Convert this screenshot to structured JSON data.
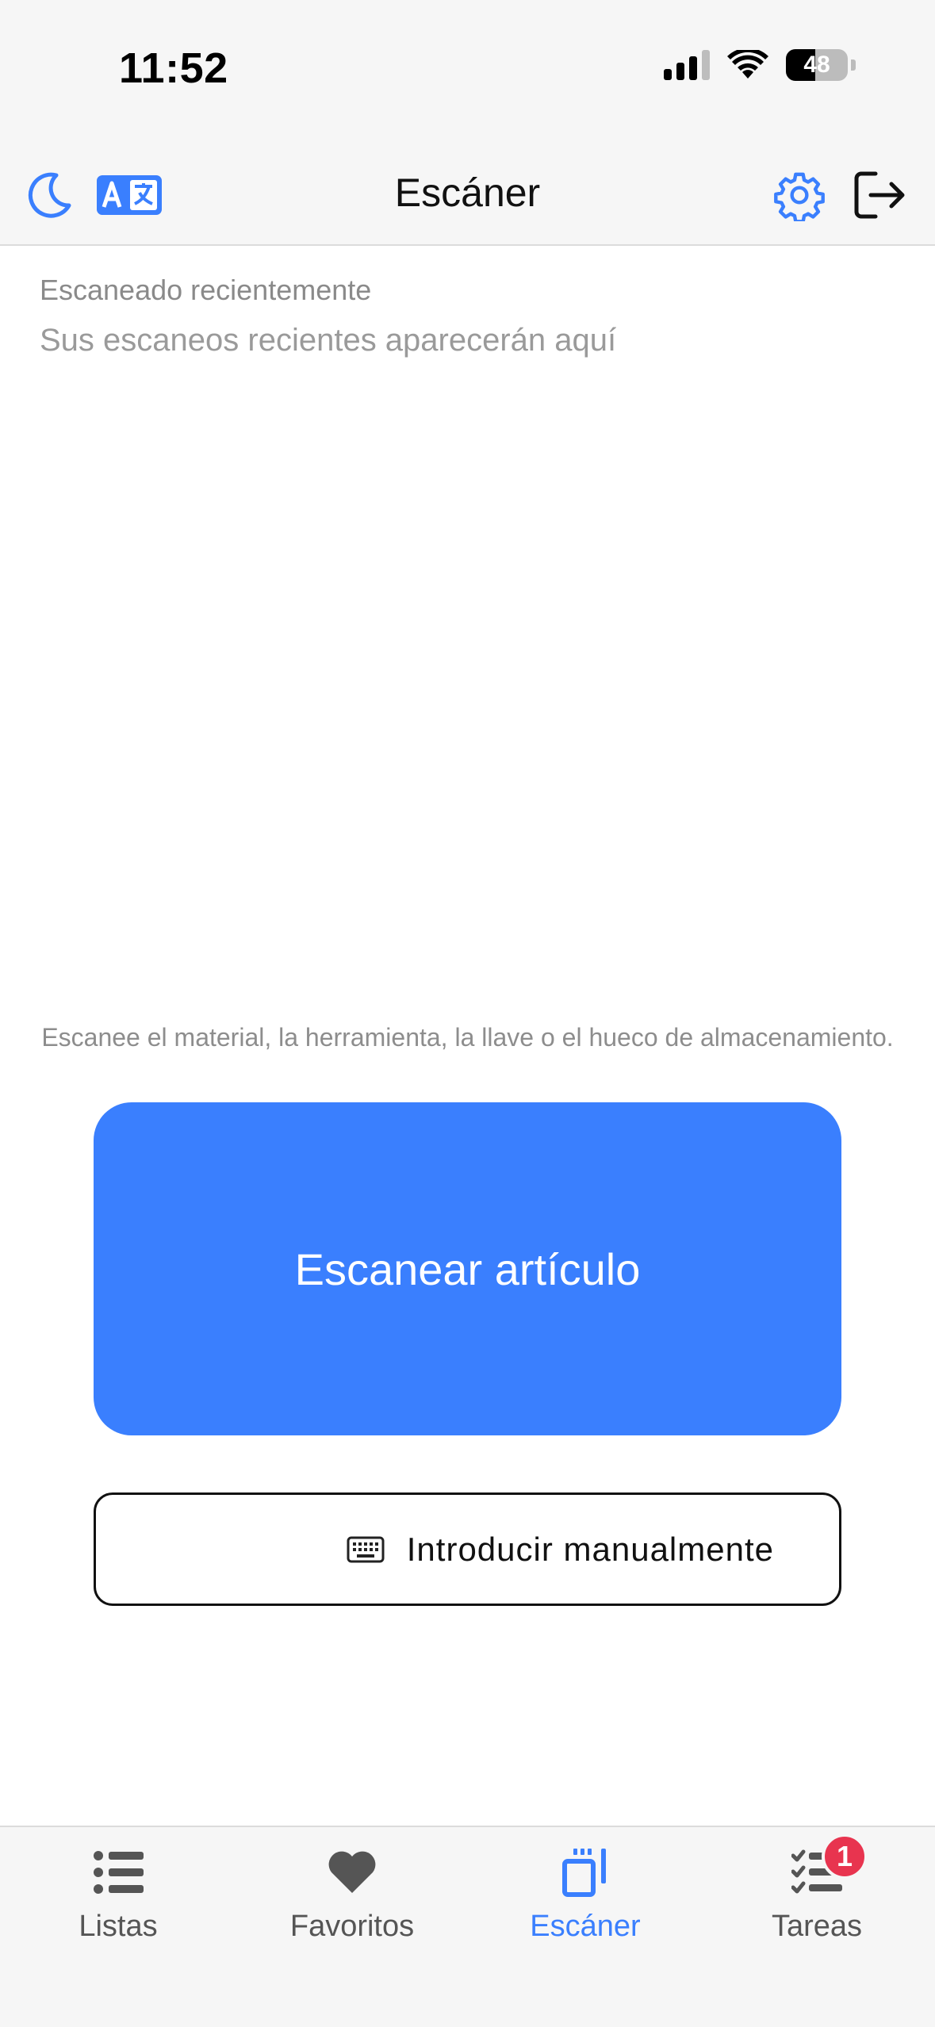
{
  "status_bar": {
    "time": "11:52",
    "battery_level": "48",
    "battery_fraction": 0.48
  },
  "header": {
    "title": "Escáner",
    "icons": {
      "left": [
        "moon-icon",
        "translate-icon"
      ],
      "right": [
        "gear-icon",
        "logout-icon"
      ]
    }
  },
  "recent": {
    "heading": "Escaneado recientemente",
    "empty_message": "Sus escaneos recientes aparecerán aquí"
  },
  "instruction": "Escanee el material, la herramienta, la llave o el hueco de almacenamiento.",
  "scan_button": {
    "label": "Escanear artículo"
  },
  "manual_button": {
    "label": "Introducir manualmente",
    "icon": "keyboard-icon"
  },
  "tabs": [
    {
      "label": "Listas",
      "icon": "list-icon",
      "active": false
    },
    {
      "label": "Favoritos",
      "icon": "heart-icon",
      "active": false
    },
    {
      "label": "Escáner",
      "icon": "scanner-icon",
      "active": true
    },
    {
      "label": "Tareas",
      "icon": "tasks-icon",
      "active": false,
      "badge": "1"
    }
  ],
  "colors": {
    "accent": "#3a7ffe",
    "badge": "#e8344f",
    "bar_background": "#f6f6f6"
  }
}
